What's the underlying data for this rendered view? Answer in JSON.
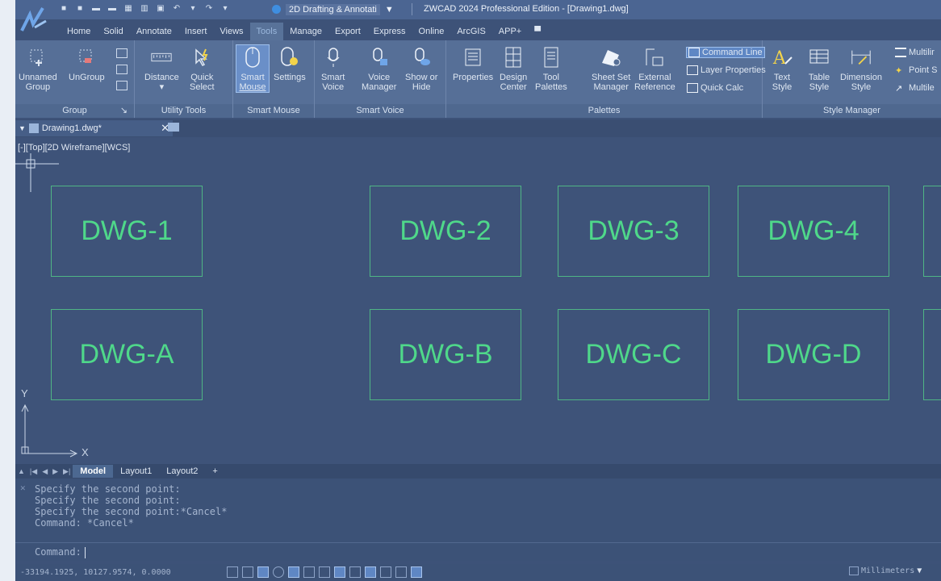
{
  "titlebar": {
    "workspace": "2D Drafting & Annotati",
    "app_title": "ZWCAD 2024 Professional Edition - [Drawing1.dwg]"
  },
  "tabs": [
    "Home",
    "Solid",
    "Annotate",
    "Insert",
    "Views",
    "Tools",
    "Manage",
    "Export",
    "Express",
    "Online",
    "ArcGIS",
    "APP+"
  ],
  "active_tab": "Tools",
  "ribbon": {
    "group": {
      "label": "Group",
      "unnamed_group": [
        "Unnamed",
        "Group"
      ],
      "ungroup": "UnGroup"
    },
    "utility_tools": {
      "label": "Utility Tools",
      "distance": "Distance",
      "quick_select": [
        "Quick",
        "Select"
      ]
    },
    "smart_mouse": {
      "label": "Smart Mouse",
      "smart_mouse": [
        "Smart",
        "Mouse"
      ],
      "settings": "Settings"
    },
    "smart_voice": {
      "label": "Smart Voice",
      "smart_voice": [
        "Smart",
        "Voice"
      ],
      "voice_manager": [
        "Voice",
        "Manager"
      ],
      "show_or_hide": [
        "Show or",
        "Hide"
      ]
    },
    "palettes": {
      "label": "Palettes",
      "properties": "Properties",
      "design_center": [
        "Design",
        "Center"
      ],
      "tool_palettes": [
        "Tool",
        "Palettes"
      ],
      "sheet_set_manager": [
        "Sheet Set",
        "Manager"
      ],
      "external_reference": [
        "External",
        "Reference"
      ],
      "command_line": "Command Line",
      "layer_properties": "Layer Properties",
      "quick_calc": "Quick Calc"
    },
    "style_manager": {
      "label": "Style Manager",
      "text_style": [
        "Text",
        "Style"
      ],
      "table_style": [
        "Table",
        "Style"
      ],
      "dimension_style": [
        "Dimension",
        "Style"
      ],
      "multiline": "Multilir",
      "point_style": "Point S",
      "multileader": "Multile"
    }
  },
  "document": {
    "tab_name": "Drawing1.dwg*",
    "viewport_label": "[-][Top][2D Wireframe][WCS]"
  },
  "drawings_top": [
    "DWG-1",
    "DWG-2",
    "DWG-3",
    "DWG-4"
  ],
  "drawings_bottom": [
    "DWG-A",
    "DWG-B",
    "DWG-C",
    "DWG-D"
  ],
  "ucs": {
    "y": "Y",
    "x": "X"
  },
  "layout_tabs": [
    "Model",
    "Layout1",
    "Layout2",
    "+"
  ],
  "active_layout": "Model",
  "command": {
    "history": [
      "Specify the second point:",
      "Specify the second point:",
      "Specify the second point:*Cancel*",
      "Command: *Cancel*"
    ],
    "prompt": "Command:"
  },
  "status": {
    "coords": "-33194.1925, 10127.9574, 0.0000",
    "units": "Millimeters"
  },
  "colors": {
    "accent": "#5f87c4",
    "drawing_text": "#4fd88a",
    "drawing_border": "#4fb585"
  }
}
